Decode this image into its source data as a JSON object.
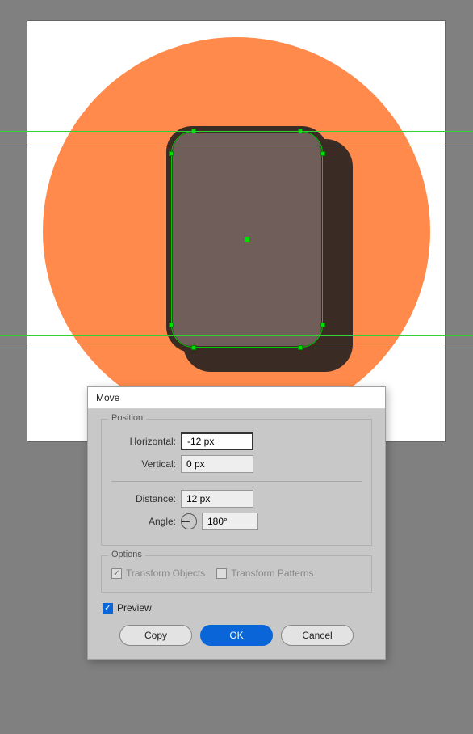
{
  "dialog": {
    "title": "Move",
    "position": {
      "label": "Position",
      "horizontal_label": "Horizontal:",
      "horizontal_value": "-12 px",
      "vertical_label": "Vertical:",
      "vertical_value": "0 px",
      "distance_label": "Distance:",
      "distance_value": "12 px",
      "angle_label": "Angle:",
      "angle_value": "180°"
    },
    "options": {
      "label": "Options",
      "transform_objects": "Transform Objects",
      "transform_patterns": "Transform Patterns"
    },
    "preview_label": "Preview",
    "buttons": {
      "copy": "Copy",
      "ok": "OK",
      "cancel": "Cancel"
    }
  }
}
